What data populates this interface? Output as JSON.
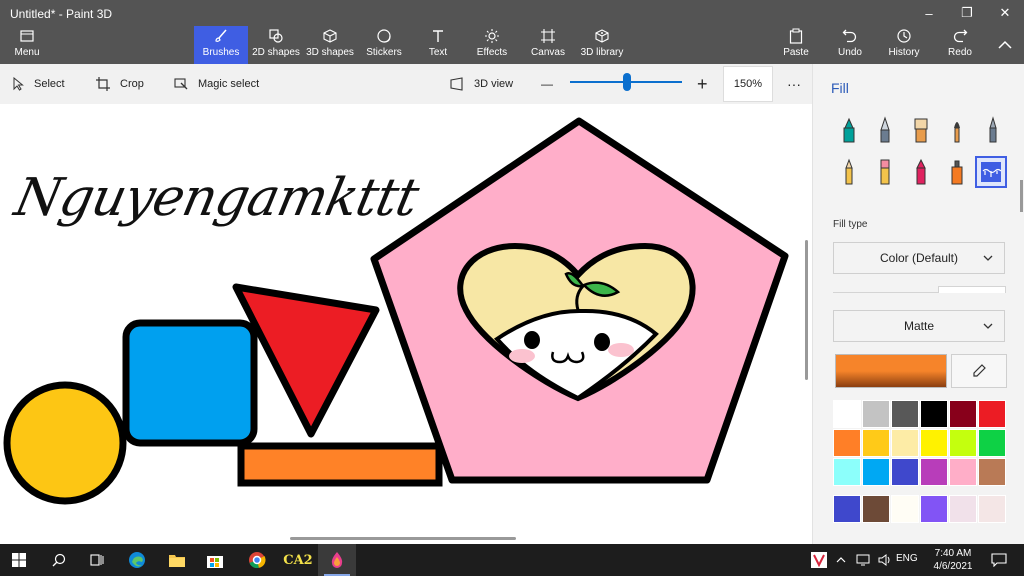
{
  "app": {
    "title": "Untitled* - Paint 3D"
  },
  "window_controls": {
    "minimize": "–",
    "maximize": "❐",
    "close": "✕"
  },
  "ribbon": {
    "menu": "Menu",
    "tabs": [
      "Brushes",
      "2D shapes",
      "3D shapes",
      "Stickers",
      "Text",
      "Effects",
      "Canvas",
      "3D library"
    ],
    "active_tab": "Brushes",
    "paste": "Paste",
    "undo": "Undo",
    "history": "History",
    "redo": "Redo"
  },
  "toolbar": {
    "select": "Select",
    "crop": "Crop",
    "magic_select": "Magic select",
    "view_3d": "3D view",
    "zoom_minus": "—",
    "zoom_plus": "+",
    "zoom": "150%",
    "more": "···"
  },
  "canvas": {
    "signature": "Nguyengamkttt",
    "shapes": [
      {
        "name": "circle",
        "fill": "#fdc614"
      },
      {
        "name": "square",
        "fill": "#00a0ef"
      },
      {
        "name": "triangle",
        "fill": "#ec1d24"
      },
      {
        "name": "rectangle",
        "fill": "#ff8227"
      },
      {
        "name": "pentagon",
        "fill": "#ffaec9"
      },
      {
        "name": "heart",
        "fill": "#f7e7a5"
      },
      {
        "name": "sprout",
        "fill": "#3cb54a"
      }
    ]
  },
  "panel": {
    "title": "Fill",
    "brushes": [
      "marker",
      "calligraphy-pen",
      "oil-brush",
      "watercolor",
      "pixel-pen",
      "pencil",
      "eraser",
      "crayon",
      "spray-can",
      "fill"
    ],
    "selected_brush": "fill",
    "fill_type_label": "Fill type",
    "fill_type_value": "Color (Default)",
    "finish_value": "Matte",
    "current_color": "#f6842a",
    "palette": [
      "#ffffff",
      "#c3c3c3",
      "#585858",
      "#000000",
      "#88001b",
      "#ec1c24",
      "#ff7f27",
      "#ffca18",
      "#fdeca6",
      "#fff200",
      "#c4ff0e",
      "#0ed145",
      "#8cfffb",
      "#00a8f3",
      "#3f48cc",
      "#b83dba",
      "#ffaec8",
      "#b97a56",
      "#3f48cc",
      "#6d4a37",
      "#fffdf5",
      "#8254f5",
      "#f1e1ea",
      "#f4e6e6"
    ]
  },
  "taskbar": {
    "apps": [
      "windows-start",
      "search",
      "task-view",
      "edge",
      "file-explorer",
      "store",
      "chrome",
      "ca2",
      "paint-3d"
    ],
    "ca2_label": "CA2",
    "language": "ENG",
    "time": "7:40 AM",
    "date": "4/6/2021"
  }
}
